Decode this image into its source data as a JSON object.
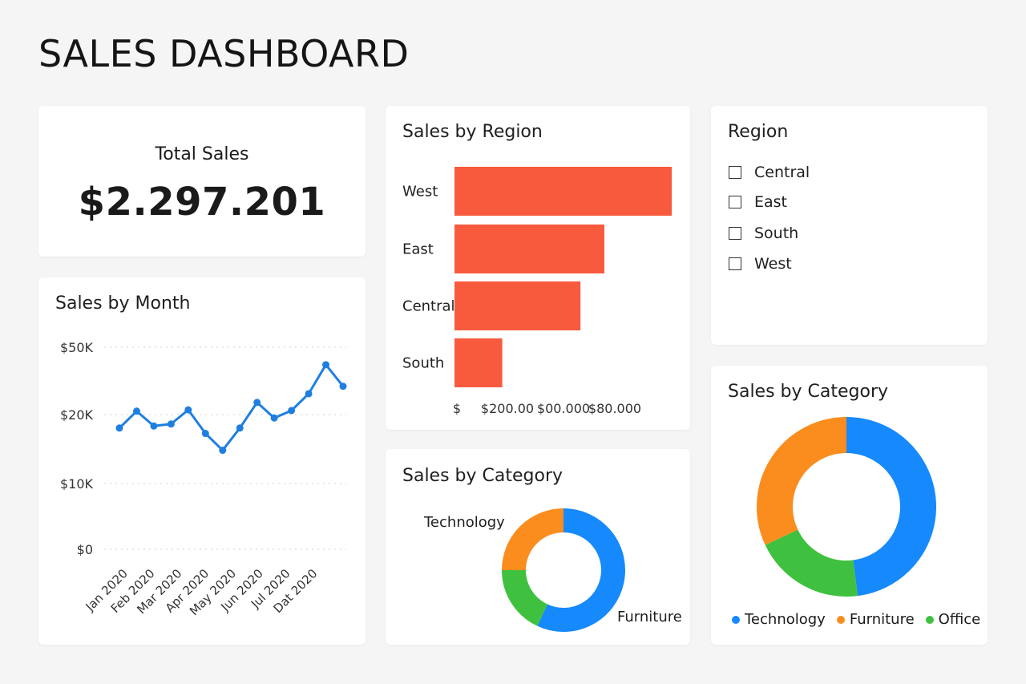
{
  "page": {
    "title": "SALES DASHBOARD"
  },
  "kpi": {
    "label": "Total Sales",
    "value": "$2.297.201"
  },
  "filter": {
    "title": "Region",
    "options": [
      "Central",
      "East",
      "South",
      "West"
    ]
  },
  "colors": {
    "bar": "#f85a3e",
    "line": "#1e7fe0",
    "technology": "#1689fc",
    "furniture": "#fb8c1e",
    "office": "#3fc13f"
  },
  "chart_data": [
    {
      "id": "sales-by-month",
      "type": "line",
      "title": "Sales by Month",
      "x_tick_labels": [
        "Jan 2020",
        "Feb 2020",
        "Mar 2020",
        "Apr 2020",
        "May 2020",
        "Jun 2020",
        "Jul 2020",
        "Dat 2020"
      ],
      "y_tick_labels": [
        "$50K",
        "$20K",
        "$10K",
        "$0"
      ],
      "values": [
        18000,
        20500,
        18300,
        18600,
        20700,
        17200,
        14700,
        18000,
        21800,
        19500,
        20600,
        23100,
        27400,
        24200
      ],
      "grid": true
    },
    {
      "id": "sales-by-region",
      "type": "bar",
      "orientation": "horizontal",
      "title": "Sales by Region",
      "categories": [
        "West",
        "East",
        "Central",
        "South"
      ],
      "values": [
        100,
        69,
        58,
        22
      ],
      "x_tick_labels": [
        "$",
        "$200.00",
        "$00.000",
        "$80.000"
      ]
    },
    {
      "id": "sales-by-category-small",
      "type": "pie",
      "title": "Sales by Category",
      "labels": [
        "Furniture",
        "Office",
        "Technology"
      ],
      "values": [
        57,
        18,
        25
      ],
      "label_texts": [
        "Technology",
        "Furniture"
      ]
    },
    {
      "id": "sales-by-category-big",
      "type": "pie",
      "title": "Sales by Category",
      "labels": [
        "Technology",
        "Office",
        "Furniture"
      ],
      "values": [
        48,
        20,
        32
      ],
      "legend": [
        "Technology",
        "Furniture",
        "Office"
      ],
      "legend_position": "bottom"
    }
  ]
}
